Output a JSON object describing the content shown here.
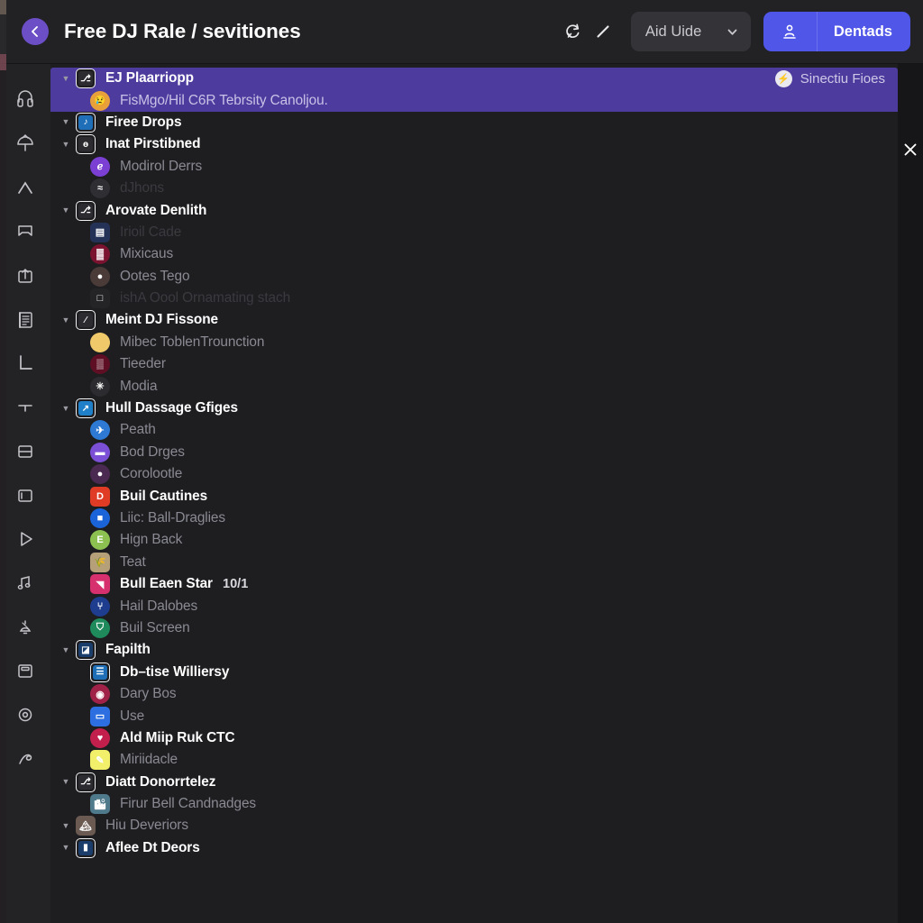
{
  "header": {
    "back_icon": "chevron-left-icon",
    "title": "Free DJ Rale / sevitiones",
    "refresh_icon": "refresh-icon",
    "edit_icon": "pencil-icon",
    "dropdown_label": "Aid Uide",
    "dropdown_chevron": "chevron-down-icon",
    "primary_icon": "person-icon",
    "primary_label": "Dentads"
  },
  "rail": {
    "items": [
      {
        "name": "headphones-icon"
      },
      {
        "name": "umbrella-icon"
      },
      {
        "name": "chevron-up-icon"
      },
      {
        "name": "bookmark-icon"
      },
      {
        "name": "inbox-upload-icon"
      },
      {
        "name": "document-list-icon"
      },
      {
        "name": "corner-bracket-icon"
      },
      {
        "name": "tee-icon"
      },
      {
        "name": "split-panel-icon"
      },
      {
        "name": "window-icon"
      },
      {
        "name": "play-icon"
      },
      {
        "name": "music-note-icon"
      },
      {
        "name": "bell-icon"
      },
      {
        "name": "card-icon"
      },
      {
        "name": "target-icon"
      },
      {
        "name": "scribble-icon"
      }
    ]
  },
  "close_rail": {
    "close_icon": "close-icon"
  },
  "list": {
    "rows": [
      {
        "label": "EJ Plaarriopp",
        "indent": 0,
        "caret": true,
        "style": "selected-first",
        "icon": {
          "kind": "framed",
          "glyph": "⎇",
          "color": "#2b2b30"
        },
        "right": {
          "icon": "bolt-circle-icon",
          "label": "Sinectiu Fioes"
        }
      },
      {
        "label": "FisMgo/Hil C6R Tebrsity Canoljou.",
        "indent": 1,
        "caret": false,
        "style": "selected-sub",
        "icon": {
          "kind": "circle",
          "glyph": "😢",
          "color": "#e8a13a"
        }
      },
      {
        "label": "Firee Drops",
        "indent": 0,
        "caret": true,
        "style": "bold",
        "icon": {
          "kind": "framed",
          "glyph": "♪",
          "color": "#1f6fb8"
        }
      },
      {
        "label": "Inat Pirstibned",
        "indent": 0,
        "caret": true,
        "style": "bold",
        "icon": {
          "kind": "framed",
          "glyph": "ɵ",
          "color": "#2b2b30"
        }
      },
      {
        "label": "Modirol Derrs",
        "indent": 1,
        "caret": false,
        "style": "dim",
        "icon": {
          "kind": "circle",
          "glyph": "ℯ",
          "color": "#7b3fd4"
        }
      },
      {
        "label": "dJhons",
        "indent": 1,
        "caret": false,
        "style": "faint",
        "icon": {
          "kind": "circle",
          "glyph": "≈",
          "color": "#2e2e33"
        }
      },
      {
        "label": "Arovate Denlith",
        "indent": 0,
        "caret": true,
        "style": "bold",
        "icon": {
          "kind": "framed",
          "glyph": "⎇",
          "color": "#2b2b30"
        }
      },
      {
        "label": "Irioil Cade",
        "indent": 1,
        "caret": false,
        "style": "faint",
        "icon": {
          "kind": "square",
          "glyph": "▤",
          "color": "#243257"
        }
      },
      {
        "label": "Mixicaus",
        "indent": 1,
        "caret": false,
        "style": "dim",
        "icon": {
          "kind": "circle",
          "glyph": "▓",
          "color": "#7a1230"
        }
      },
      {
        "label": "Ootes Tego",
        "indent": 1,
        "caret": false,
        "style": "dim",
        "icon": {
          "kind": "circle",
          "glyph": "●",
          "color": "#4a3b38"
        }
      },
      {
        "label": "ishA Oool Ornamating stach",
        "indent": 1,
        "caret": false,
        "style": "faint",
        "icon": {
          "kind": "square",
          "glyph": "□",
          "color": "#242427"
        }
      },
      {
        "label": "Meint DJ Fissone",
        "indent": 0,
        "caret": true,
        "style": "bold",
        "icon": {
          "kind": "framed",
          "glyph": "∕",
          "color": "#2b2b30"
        }
      },
      {
        "label": "Mibec ToblenTrounction",
        "indent": 1,
        "caret": false,
        "style": "dim",
        "icon": {
          "kind": "circle",
          "glyph": "",
          "color": "#f0c96a"
        }
      },
      {
        "label": "Tieeder",
        "indent": 1,
        "caret": false,
        "style": "dim",
        "icon": {
          "kind": "circle",
          "glyph": "▒",
          "color": "#5e0f24"
        }
      },
      {
        "label": "Modia",
        "indent": 1,
        "caret": false,
        "style": "dim",
        "icon": {
          "kind": "circle",
          "glyph": "✳",
          "color": "#2b2b30"
        }
      },
      {
        "label": "Hull Dassage Gfiges",
        "indent": 0,
        "caret": true,
        "style": "bold",
        "icon": {
          "kind": "framed",
          "glyph": "↗",
          "color": "#1f7fc8"
        }
      },
      {
        "label": "Peath",
        "indent": 1,
        "caret": false,
        "style": "dim",
        "icon": {
          "kind": "circle",
          "glyph": "✈",
          "color": "#2d79d4"
        }
      },
      {
        "label": "Bod Drges",
        "indent": 1,
        "caret": false,
        "style": "dim",
        "icon": {
          "kind": "circle",
          "glyph": "▬",
          "color": "#7b4fd6"
        }
      },
      {
        "label": "Corolootle",
        "indent": 1,
        "caret": false,
        "style": "dim",
        "icon": {
          "kind": "circle",
          "glyph": "●",
          "color": "#4a2a50"
        }
      },
      {
        "label": "Buil Cautines",
        "indent": 1,
        "caret": false,
        "style": "bold",
        "icon": {
          "kind": "square",
          "glyph": "D",
          "color": "#e03b24"
        }
      },
      {
        "label": "Liic: Ball-Draglies",
        "indent": 1,
        "caret": false,
        "style": "dim",
        "icon": {
          "kind": "circle",
          "glyph": "■",
          "color": "#1b63d8"
        }
      },
      {
        "label": "Hign Back",
        "indent": 1,
        "caret": false,
        "style": "dim",
        "icon": {
          "kind": "circle",
          "glyph": "E",
          "color": "#8cc152"
        }
      },
      {
        "label": "Teat",
        "indent": 1,
        "caret": false,
        "style": "dim",
        "icon": {
          "kind": "square",
          "glyph": "🌾",
          "color": "#b5a07a"
        }
      },
      {
        "label": "Bull Eaen Star",
        "indent": 1,
        "caret": false,
        "style": "bold",
        "badge": "10/1",
        "icon": {
          "kind": "square",
          "glyph": "◥",
          "color": "#d6306e"
        }
      },
      {
        "label": "Hail Dalobes",
        "indent": 1,
        "caret": false,
        "style": "dim",
        "icon": {
          "kind": "circle",
          "glyph": "⑂",
          "color": "#1f3d8f"
        }
      },
      {
        "label": "Buil Screen",
        "indent": 1,
        "caret": false,
        "style": "dim",
        "icon": {
          "kind": "circle",
          "glyph": "⛉",
          "color": "#1f8a5c"
        }
      },
      {
        "label": "Fapilth",
        "indent": 0,
        "caret": true,
        "style": "bold",
        "icon": {
          "kind": "framed",
          "glyph": "◪",
          "color": "#1a3d6b"
        }
      },
      {
        "label": "Db–tise Williersy",
        "indent": 1,
        "caret": false,
        "style": "bold",
        "icon": {
          "kind": "framed",
          "glyph": "☰",
          "color": "#1f6fb8"
        }
      },
      {
        "label": "Dary Bos",
        "indent": 1,
        "caret": false,
        "style": "dim",
        "icon": {
          "kind": "circle",
          "glyph": "◉",
          "color": "#a02248"
        }
      },
      {
        "label": "Use",
        "indent": 1,
        "caret": false,
        "style": "dim",
        "icon": {
          "kind": "square",
          "glyph": "▭",
          "color": "#2d6fe0"
        }
      },
      {
        "label": "Ald Miip Ruk CTC",
        "indent": 1,
        "caret": false,
        "style": "bold",
        "icon": {
          "kind": "circle",
          "glyph": "♥",
          "color": "#c21f4d"
        }
      },
      {
        "label": "Miriidacle",
        "indent": 1,
        "caret": false,
        "style": "dim",
        "icon": {
          "kind": "square",
          "glyph": "✎",
          "color": "#f2ef6a"
        }
      },
      {
        "label": "Diatt Donorrtelez",
        "indent": 0,
        "caret": true,
        "style": "bold",
        "icon": {
          "kind": "framed",
          "glyph": "⎇",
          "color": "#2b2b30"
        }
      },
      {
        "label": "Firur Bell Candnadges",
        "indent": 1,
        "caret": false,
        "style": "dim",
        "icon": {
          "kind": "square",
          "glyph": "🏙",
          "color": "#4f7a8c"
        }
      },
      {
        "label": "Hiu Deveriors",
        "indent": 0,
        "caret": true,
        "style": "dim",
        "icon": {
          "kind": "square",
          "glyph": "🏔",
          "color": "#6b5a52"
        }
      },
      {
        "label": "Aflee Dt Deors",
        "indent": 0,
        "caret": true,
        "style": "bold",
        "icon": {
          "kind": "framed",
          "glyph": "▮",
          "color": "#1a3d6b"
        }
      }
    ]
  }
}
